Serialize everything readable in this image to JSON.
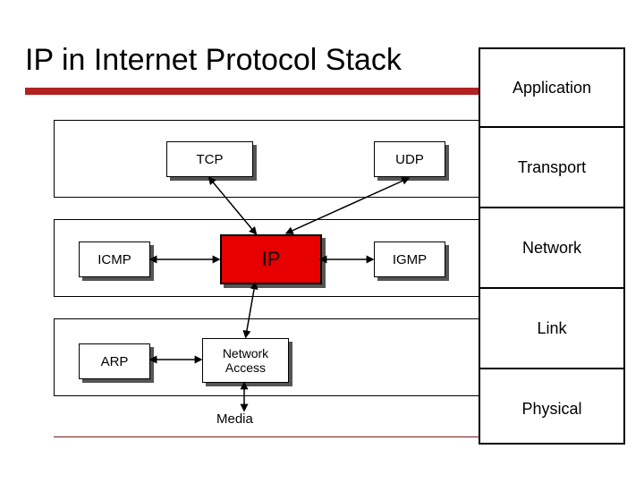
{
  "title": "IP in Internet Protocol Stack",
  "protocols": {
    "tcp": "TCP",
    "udp": "UDP",
    "icmp": "ICMP",
    "igmp": "IGMP",
    "ip": "IP",
    "network_access": "Network\nAccess",
    "arp": "ARP",
    "media": "Media"
  },
  "stack": {
    "application": "Application",
    "transport": "Transport",
    "network": "Network",
    "link": "Link",
    "physical": "Physical"
  }
}
